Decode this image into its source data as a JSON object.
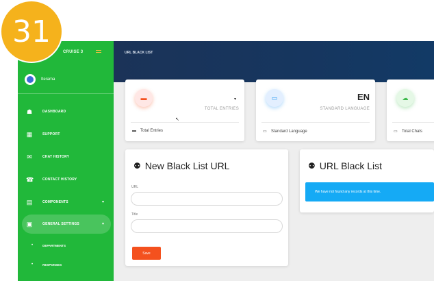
{
  "badge": "31",
  "sidebar": {
    "brand": "CRUISE 3",
    "username": "Iterama",
    "items": [
      {
        "icon": "dashboard-icon",
        "glyph": "☗",
        "label": "Dashboard"
      },
      {
        "icon": "support-icon",
        "glyph": "▦",
        "label": "Support"
      },
      {
        "icon": "chat-history-icon",
        "glyph": "✉",
        "label": "Chat History"
      },
      {
        "icon": "contact-history-icon",
        "glyph": "☎",
        "label": "Contact History"
      },
      {
        "icon": "components-icon",
        "glyph": "▤",
        "label": "Components",
        "caret": "▾"
      },
      {
        "icon": "general-settings-icon",
        "glyph": "▣",
        "label": "General Settings",
        "caret": "▾"
      }
    ],
    "sub_items": [
      {
        "label": "Departments"
      },
      {
        "label": "Responses"
      }
    ]
  },
  "header": {
    "breadcrumb": "URL Black List"
  },
  "stats": [
    {
      "value": "",
      "caption": "Total Entries",
      "footer": "Total Entries",
      "icon": "entries-icon",
      "glyph": "▬",
      "accent": "#f4511e"
    },
    {
      "value": "EN",
      "caption": "Standard Language",
      "footer": "Standard Language",
      "icon": "language-icon",
      "glyph": "▭",
      "accent": "#2196f3"
    },
    {
      "value": "",
      "caption": "",
      "footer": "Total Chats",
      "icon": "chats-icon",
      "glyph": "☁",
      "accent": "#3bb94a"
    }
  ],
  "form": {
    "title": "New Black List URL",
    "url_label": "URL",
    "title_label": "Title",
    "url_value": "",
    "title_value": "",
    "save_label": "Save"
  },
  "list": {
    "title": "URL Black List",
    "empty_message": "We have not found any records at this time."
  },
  "colors": {
    "sidebar": "#21b83a",
    "header": "#1b3358",
    "accent_orange": "#f4511e",
    "alert_blue": "#15aaf5",
    "badge": "#f5b21c"
  }
}
